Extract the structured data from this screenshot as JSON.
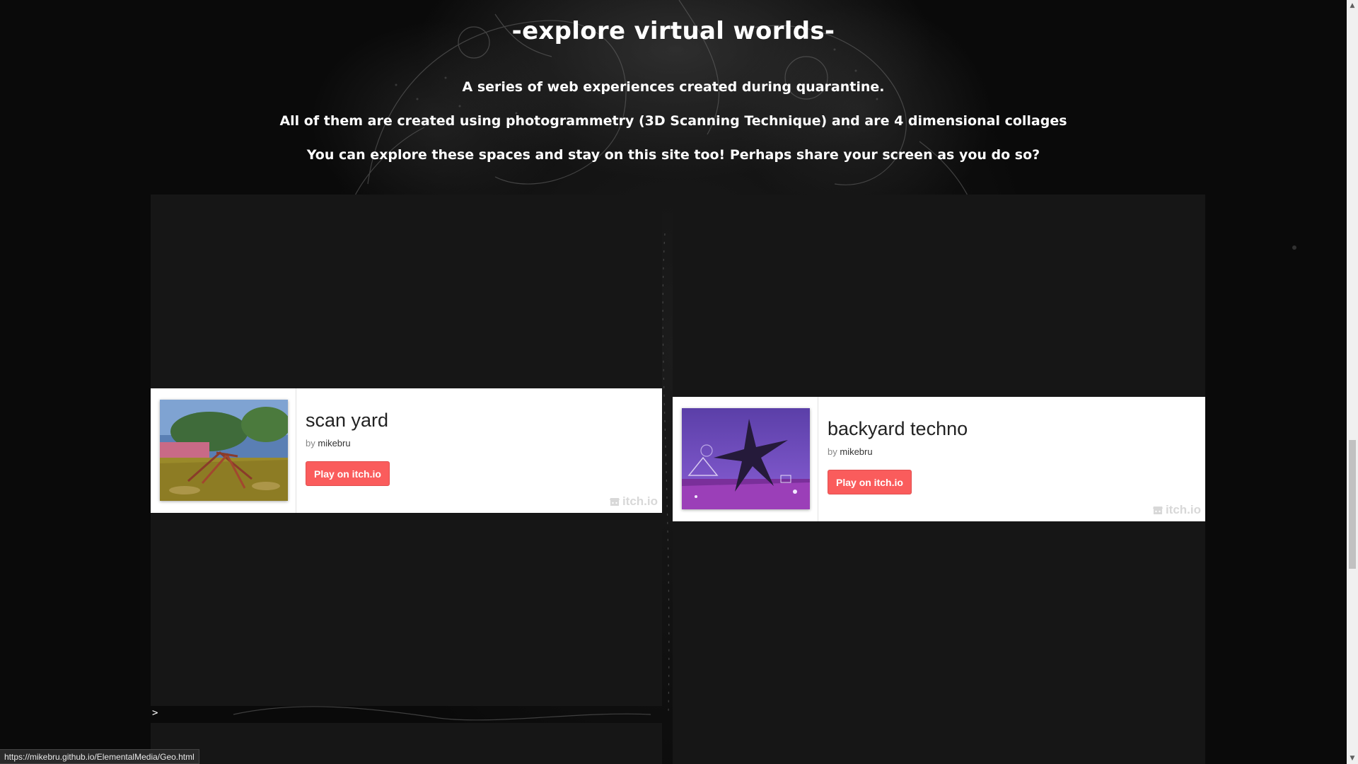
{
  "header": {
    "title": "-explore virtual worlds-",
    "intro_lines": [
      "A series of web experiences created during quarantine.",
      "All of them are created using photogrammetry (3D Scanning Technique) and are 4 dimensional collages",
      "You can explore these spaces and stay on this site too! Perhaps share your screen as you do so?"
    ]
  },
  "games": [
    {
      "title": "scan yard",
      "by_prefix": "by",
      "author": "mikebru",
      "button_label": "Play on itch.io",
      "badge": "itch.io"
    },
    {
      "title": "backyard techno",
      "by_prefix": "by",
      "author": "mikebru",
      "button_label": "Play on itch.io",
      "badge": "itch.io"
    }
  ],
  "prompt_text": ">",
  "status_bar": {
    "url": "https://mikebru.github.io/ElementalMedia/Geo.html"
  },
  "colors": {
    "page_background": "#0c0c0c",
    "embed_background": "#161616",
    "play_button": "#fa5c5c",
    "scrollbar_track": "#f0f0f0",
    "scrollbar_thumb": "#c1c1c1"
  }
}
